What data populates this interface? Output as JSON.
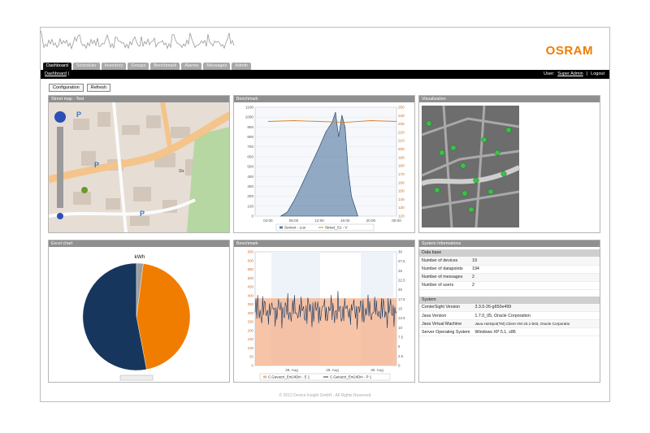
{
  "brand": "OSRAM",
  "tabs": [
    "Dashboard",
    "Scheduler",
    "Inventory",
    "Groups",
    "Benchmark",
    "Alarms",
    "Messages",
    "Admin"
  ],
  "breadcrumb": "Dashboard",
  "user_label": "User:",
  "user_name": "Super Admin",
  "logout": "Logout",
  "buttons": {
    "configuration": "Configuration",
    "refresh": "Refresh"
  },
  "panels": {
    "street_map": "Street map - Test",
    "benchmark1": "Benchmark",
    "visualization": "Visualization",
    "excel": "Excel chart",
    "benchmark2": "Benchmark",
    "system": "System Informations"
  },
  "system_info": {
    "database_title": "Data base",
    "database_rows": [
      {
        "label": "Number of devices",
        "value": "19"
      },
      {
        "label": "Number of datapoints",
        "value": "194"
      },
      {
        "label": "Number of messages",
        "value": "2"
      },
      {
        "label": "Number of users",
        "value": "2"
      }
    ],
    "system_title": "System",
    "system_rows": [
      {
        "label": "CenterSight Version",
        "value": "3.3.0-26-g650e499"
      },
      {
        "label": "Java Version",
        "value": "1.7.0_05, Oracle Corporation"
      },
      {
        "label": "Java Virtual Machine",
        "value": "Java HotSpot(TM) Client VM 23.1-b03, Oracle Corporatio"
      },
      {
        "label": "Server Operating System",
        "value": "Windows XP 5.1, x86"
      }
    ]
  },
  "footer": "© 2012 Device Insight GmbH - All Rights Reserved",
  "colors": {
    "accent": "#f07d00",
    "navy": "#17365d",
    "steel": "#5b7ea4"
  },
  "chart_data": [
    {
      "type": "area",
      "title": "",
      "x_ticks": [
        "04:00",
        "08:00",
        "12:00",
        "16:00",
        "20:00",
        "00:00"
      ],
      "y_left_ticks": [
        0,
        100,
        200,
        300,
        400,
        500,
        600,
        700,
        800,
        900,
        1000,
        1100
      ],
      "y_right_ticks": [
        120,
        130,
        140,
        150,
        160,
        170,
        180,
        190,
        200,
        210,
        220,
        230,
        240,
        250
      ],
      "ylim_left": [
        0,
        1100
      ],
      "ylim_right": [
        120,
        250
      ],
      "series": [
        {
          "name": "Sensor - Lux",
          "color": "#5b7ea4",
          "x": [
            "06:00",
            "07:00",
            "08:00",
            "09:00",
            "10:00",
            "11:00",
            "12:00",
            "13:00",
            "14:00",
            "14:30",
            "15:00",
            "15:30",
            "16:00",
            "16:30",
            "17:00",
            "18:00"
          ],
          "values": [
            0,
            40,
            150,
            280,
            420,
            560,
            700,
            850,
            950,
            1050,
            800,
            1020,
            900,
            450,
            200,
            0
          ]
        },
        {
          "name": "Street_S1 - V",
          "color": "#d9822b",
          "x": [
            "04:00",
            "08:00",
            "12:00",
            "16:00",
            "20:00",
            "00:00"
          ],
          "values": [
            233,
            234,
            233,
            232,
            234,
            233
          ]
        }
      ]
    },
    {
      "type": "pie",
      "title": "kWh",
      "series": [
        {
          "name": "",
          "values": [
            53,
            45,
            2
          ],
          "colors": [
            "#17365d",
            "#f07d00",
            "#9e9e9e"
          ]
        }
      ]
    },
    {
      "type": "area",
      "title": "",
      "x_ticks": [
        "28. Aug",
        "29. Aug",
        "30. Aug"
      ],
      "y_left_ticks": [
        0,
        50,
        100,
        150,
        200,
        250,
        300,
        350,
        400,
        450,
        500,
        550,
        600,
        650
      ],
      "y_right_ticks": [
        0,
        2.5,
        5,
        7.5,
        10,
        12.5,
        15,
        17.5,
        20,
        22.5,
        25,
        27.5,
        30
      ],
      "ylim_left": [
        0,
        650
      ],
      "ylim_right": [
        0,
        30
      ],
      "series": [
        {
          "name": "C.Gavazzi_Em24Din - E 1",
          "color": "#f6b08a",
          "values": [
            380,
            385,
            390,
            382,
            388,
            384
          ]
        },
        {
          "name": "C.Gavazzi_Em24Din - P 1",
          "color": "#17365d",
          "values": [
            14,
            15,
            13,
            16,
            14,
            15
          ]
        }
      ]
    }
  ]
}
